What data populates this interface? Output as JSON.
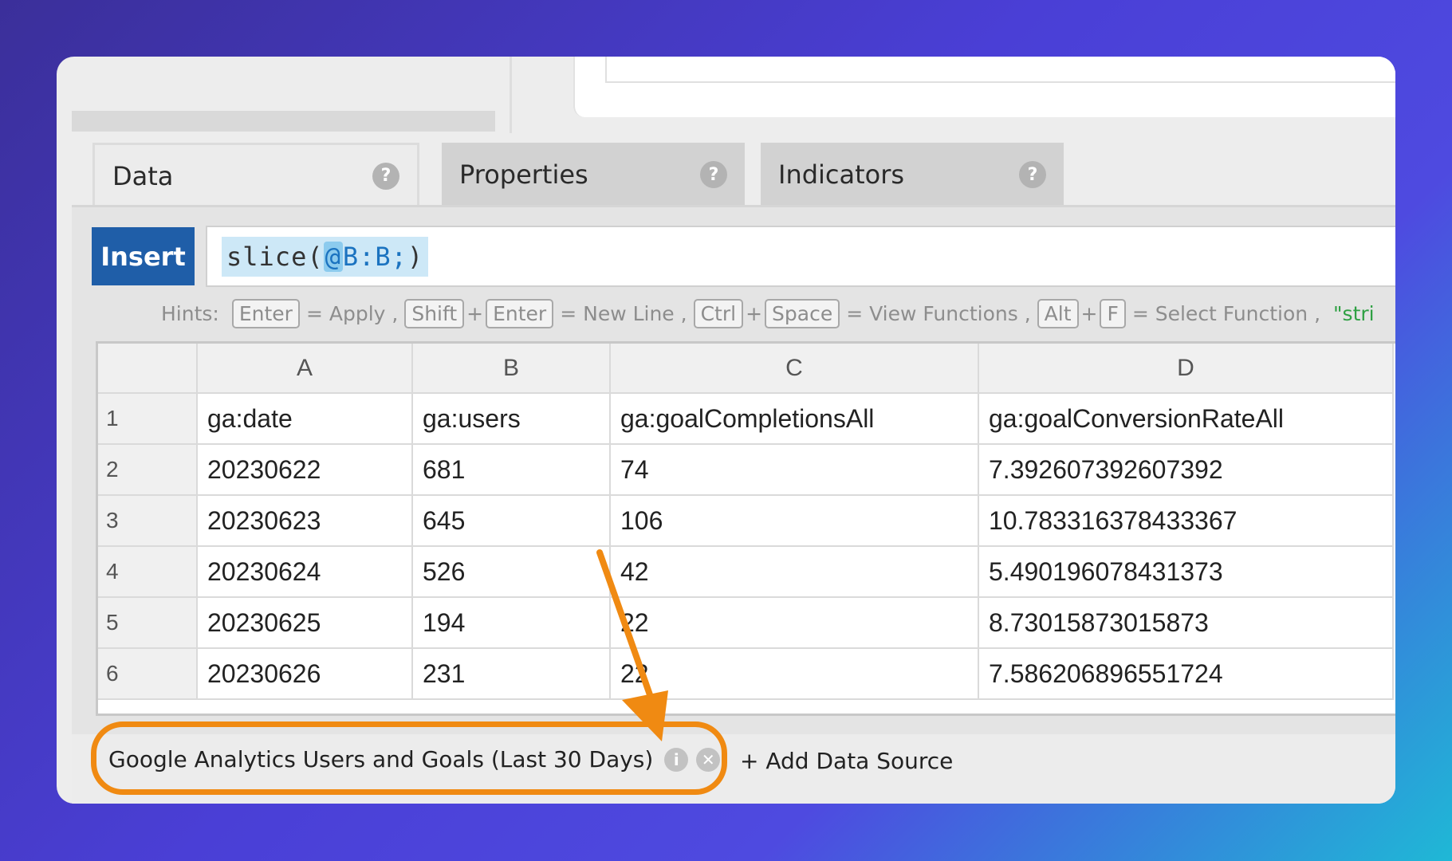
{
  "tabs": [
    {
      "label": "Data",
      "help": "?"
    },
    {
      "label": "Properties",
      "help": "?"
    },
    {
      "label": "Indicators",
      "help": "?"
    }
  ],
  "editor": {
    "insert_label": "Insert",
    "formula_prefix": "slice(",
    "formula_at": "@",
    "formula_ref": "B:B;",
    "formula_suffix": ")"
  },
  "hints": {
    "label": "Hints:",
    "enter_key": "Enter",
    "apply": "= Apply ,",
    "shift_key": "Shift",
    "enter_key_2": "Enter",
    "new_line": "= New Line ,",
    "ctrl_key": "Ctrl",
    "space_key": "Space",
    "view_functions": "= View Functions ,",
    "alt_key": "Alt",
    "f_key": "F",
    "select_function": "= Select Function ,",
    "trailing": "\"stri"
  },
  "grid": {
    "columns": [
      "A",
      "B",
      "C",
      "D"
    ],
    "rows": [
      {
        "num": "1",
        "cells": [
          "ga:date",
          "ga:users",
          "ga:goalCompletionsAll",
          "ga:goalConversionRateAll"
        ]
      },
      {
        "num": "2",
        "cells": [
          "20230622",
          "681",
          "74",
          "7.392607392607392"
        ]
      },
      {
        "num": "3",
        "cells": [
          "20230623",
          "645",
          "106",
          "10.783316378433367"
        ]
      },
      {
        "num": "4",
        "cells": [
          "20230624",
          "526",
          "42",
          "5.490196078431373"
        ]
      },
      {
        "num": "5",
        "cells": [
          "20230625",
          "194",
          "22",
          "8.73015873015873"
        ]
      },
      {
        "num": "6",
        "cells": [
          "20230626",
          "231",
          "22",
          "7.586206896551724"
        ]
      }
    ]
  },
  "data_source": {
    "name": "Google Analytics Users and Goals (Last 30 Days)",
    "info_icon": "i",
    "close_icon": "✕",
    "add_label": "+ Add Data Source"
  },
  "colors": {
    "insert_button": "#1f5ea8",
    "highlight": "#f08a12",
    "hint_string": "#2ea043"
  }
}
